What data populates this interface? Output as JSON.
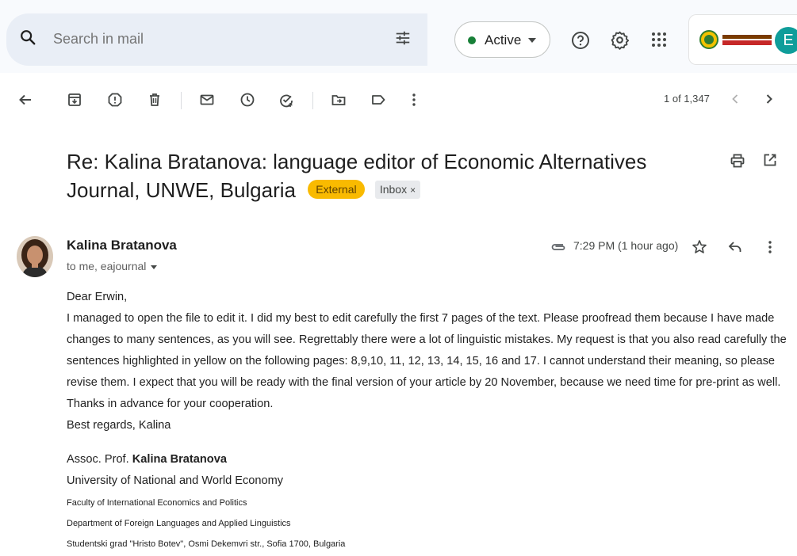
{
  "search": {
    "placeholder": "Search in mail"
  },
  "status": {
    "label": "Active",
    "color": "#188038"
  },
  "account": {
    "avatar_letter": "E",
    "org_logo": "UNIVERSITAS MULAWARMAN"
  },
  "toolbar": {
    "icons": [
      "back-arrow-icon",
      "archive-icon",
      "report-spam-icon",
      "delete-icon",
      "mark-unread-icon",
      "snooze-icon",
      "add-to-tasks-icon",
      "move-to-icon",
      "label-icon",
      "more-vert-icon"
    ]
  },
  "pager": {
    "text": "1 of 1,347"
  },
  "email": {
    "subject": "Re: Kalina Bratanova: language editor of Economic Alternatives Journal, UNWE, Bulgaria",
    "badge_external": "External",
    "badge_inbox": "Inbox",
    "sender": "Kalina Bratanova",
    "recipients": "to me, eajournal",
    "time": "7:29 PM (1 hour ago)",
    "greeting": "Dear Erwin,",
    "body": "I managed to open the file to edit it. I did my best to edit carefully the first 7 pages of the text. Please proofread them because I have made changes to many sentences, as you will see. Regrettably there were a lot of linguistic mistakes. My request is that you also read carefully the sentences highlighted in yellow on the following pages: 8,9,10, 11, 12, 13, 14, 15, 16 and 17. I cannot understand their meaning, so please revise them. I expect that you will be ready with the final version of your article by 20 November, because we need time for pre-print as well. Thanks in advance for your cooperation.",
    "closing": "Best regards, Kalina"
  },
  "signature": {
    "title_prefix": "Assoc. Prof.",
    "name": "Kalina Bratanova",
    "university": "University of National and World Economy",
    "faculty": "Faculty of International Economics and Politics",
    "department": "Department of Foreign Languages and Applied Linguistics",
    "address": "Studentski grad \"Hristo Botev\", Osmi Dekemvri str., Sofia 1700, Bulgaria"
  },
  "colors": {
    "external_badge": "#f9ba00",
    "avatar": "#0f9d9a"
  }
}
